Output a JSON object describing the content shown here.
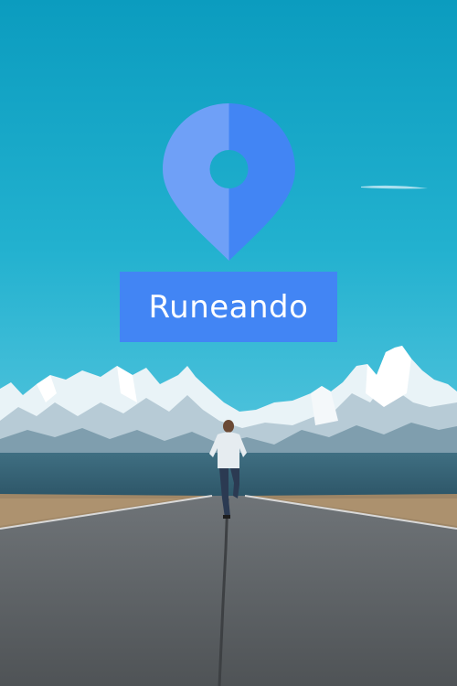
{
  "app": {
    "name": "Runeando",
    "logo_icon": "location-pin-icon",
    "brand_color": "#4285f4",
    "brand_color_light": "#6fa0f7"
  },
  "background": {
    "scene": "runner-on-road-mountains-photo"
  }
}
